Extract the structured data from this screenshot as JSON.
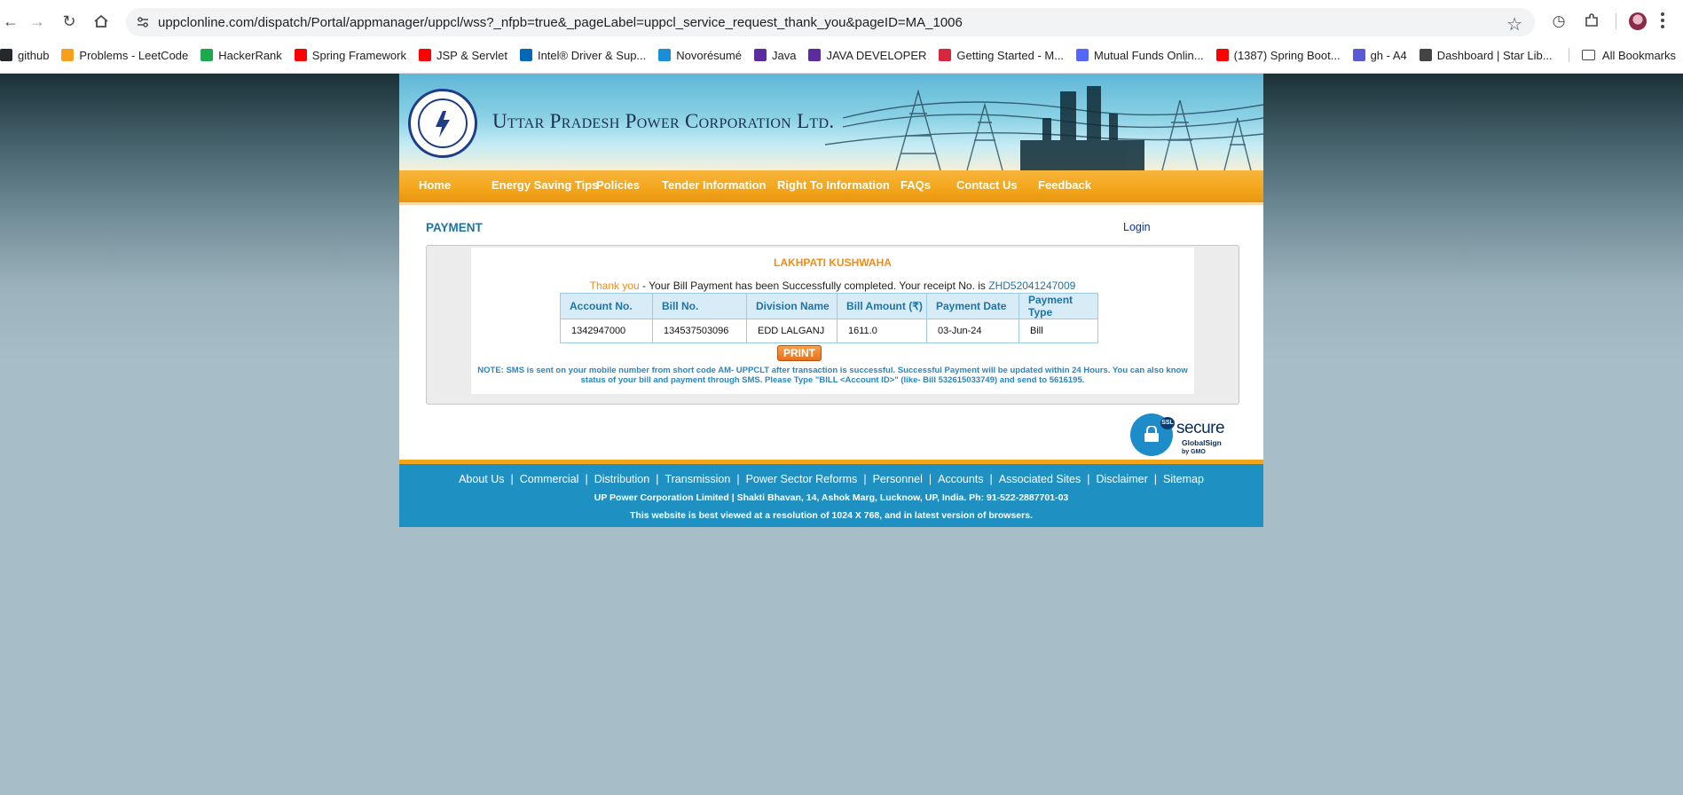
{
  "browser": {
    "url": "uppclonline.com/dispatch/Portal/appmanager/uppcl/wss?_nfpb=true&_pageLabel=uppcl_service_request_thank_you&pageID=MA_1006",
    "bookmarks": [
      {
        "label": "github",
        "icon": "github-icon",
        "color": "#24292e"
      },
      {
        "label": "Problems - LeetCode",
        "icon": "leetcode-icon",
        "color": "#f89f1b"
      },
      {
        "label": "HackerRank",
        "icon": "hackerrank-icon",
        "color": "#1ba94c"
      },
      {
        "label": "Spring Framework",
        "icon": "youtube-icon",
        "color": "#ff0000"
      },
      {
        "label": "JSP & Servlet",
        "icon": "youtube-icon",
        "color": "#ff0000"
      },
      {
        "label": "Intel® Driver & Sup...",
        "icon": "intel-icon",
        "color": "#0068b5"
      },
      {
        "label": "Novorésumé",
        "icon": "novoresume-icon",
        "color": "#1a8fd6"
      },
      {
        "label": "Java",
        "icon": "course-icon",
        "color": "#5a2ca0"
      },
      {
        "label": "JAVA DEVELOPER",
        "icon": "course-icon",
        "color": "#5a2ca0"
      },
      {
        "label": "Getting Started - M...",
        "icon": "getting-started-icon",
        "color": "#d7263d"
      },
      {
        "label": "Mutual Funds Onlin...",
        "icon": "groww-icon",
        "color": "#5367ff"
      },
      {
        "label": "(1387) Spring Boot...",
        "icon": "youtube-icon",
        "color": "#ff0000"
      },
      {
        "label": "gh - A4",
        "icon": "print-icon",
        "color": "#5a5ad6"
      },
      {
        "label": "Dashboard | Star Lib...",
        "icon": "globe-icon",
        "color": "#444444"
      }
    ],
    "all_bookmarks": "All Bookmarks"
  },
  "site": {
    "title": "Uttar Pradesh Power Corporation Ltd.",
    "menu": [
      "Home",
      "Energy Saving Tips",
      "Policies",
      "Tender Information",
      "Right To Information",
      "FAQs",
      "Contact Us",
      "Feedback"
    ],
    "page_title": "PAYMENT",
    "login": "Login"
  },
  "receipt": {
    "customer_name": "LAKHPATI KUSHWAHA",
    "thank_you": "Thank you",
    "message": " - Your Bill Payment has been Successfully completed. Your receipt No. is ",
    "receipt_no": "ZHD52041247009",
    "columns": [
      "Account No.",
      "Bill No.",
      "Division Name",
      "Bill Amount (₹)",
      "Payment Date",
      "Payment Type"
    ],
    "row": [
      "1342947000",
      "134537503096",
      "EDD LALGANJ",
      "1611.0",
      "03-Jun-24",
      "Bill"
    ],
    "print_label": "PRINT",
    "note": "NOTE: SMS is sent on your mobile number from short code AM- UPPCLT after transaction is successful. Successful Payment will be updated within 24 Hours. You can also know status of your bill and payment through SMS. Please Type \"BILL <Account ID>\" (like- Bill 532615033749) and send to 5616195."
  },
  "ssl_badge": {
    "secure": "secure",
    "brand": "GlobalSign",
    "by": "by GMO",
    "tag": "SSL"
  },
  "footer": {
    "links": [
      "About Us",
      "Commercial",
      "Distribution",
      "Transmission",
      "Power Sector Reforms",
      "Personnel",
      "Accounts",
      "Associated Sites",
      "Disclaimer",
      "Sitemap"
    ],
    "address": "UP Power Corporation Limited | Shakti Bhavan, 14, Ashok Marg, Lucknow, UP, India. Ph: 91-522-2887701-03",
    "resolution": "This website is best viewed at a resolution of 1024 X 768, and in latest version of browsers."
  }
}
